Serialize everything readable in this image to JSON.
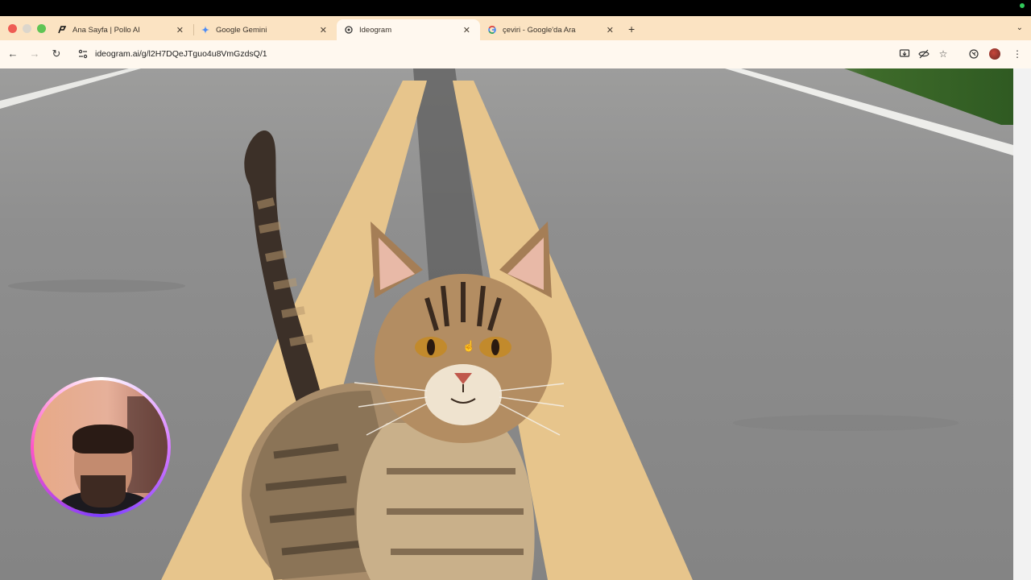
{
  "browser": {
    "tabs": [
      {
        "label": "Ana Sayfa | Pollo AI",
        "icon": "pollo-icon",
        "active": false
      },
      {
        "label": "Google Gemini",
        "icon": "gemini-icon",
        "active": false
      },
      {
        "label": "Ideogram",
        "icon": "ideogram-icon",
        "active": true
      },
      {
        "label": "çeviri - Google'da Ara",
        "icon": "google-icon",
        "active": false
      }
    ],
    "new_tab": "+",
    "tab_search": "⌄",
    "url": "ideogram.ai/g/l2H7DQeJTguo4u8VmGzdsQ/1",
    "nav": {
      "back": "←",
      "forward": "→",
      "reload": "↻"
    }
  },
  "content": {
    "image_subject": "cat-on-road",
    "colors": {
      "road": "#8f8f8f",
      "yellow_line": "#e8c98e",
      "tab_bar": "#fbe3c2",
      "toolbar": "#fff8ef"
    }
  },
  "webcam": {
    "visible": true
  }
}
